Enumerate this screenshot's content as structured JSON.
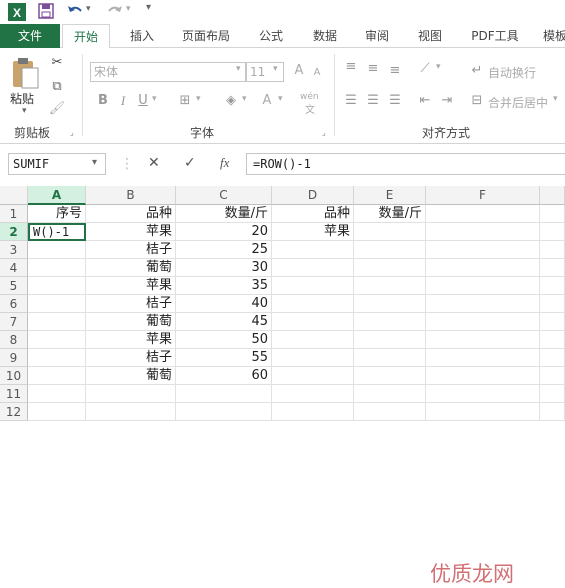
{
  "qat": {
    "excel_icon": "excel-logo-icon",
    "save_icon": "save-icon",
    "undo_icon": "undo-icon",
    "redo_icon": "redo-icon"
  },
  "tabs": {
    "file": "文件",
    "home": "开始",
    "insert": "插入",
    "layout": "页面布局",
    "formulas": "公式",
    "data": "数据",
    "review": "审阅",
    "view": "视图",
    "pdf": "PDF工具",
    "more": "模板"
  },
  "ribbon": {
    "paste": "粘贴",
    "clipboard_group": "剪贴板",
    "font_name": "宋体",
    "font_size": "11",
    "font_group": "字体",
    "bold": "B",
    "italic": "I",
    "underline": "U",
    "wen": "wén",
    "wrap": "自动换行",
    "merge": "合并后居中",
    "align_group": "对齐方式",
    "inc_font": "A",
    "dec_font": "A",
    "font_color": "A"
  },
  "formula_bar": {
    "name_box": "SUMIF",
    "cancel": "✕",
    "enter": "✓",
    "fx": "fx",
    "formula": "=ROW()-1"
  },
  "grid": {
    "columns": [
      "A",
      "B",
      "C",
      "D",
      "E",
      "F"
    ],
    "rows": [
      "1",
      "2",
      "3",
      "4",
      "5",
      "6",
      "7",
      "8",
      "9",
      "10",
      "11",
      "12"
    ],
    "cells": [
      [
        "序号",
        "品种",
        "数量/斤",
        "品种",
        "数量/斤",
        ""
      ],
      [
        "W()-1",
        "苹果",
        "20",
        "苹果",
        "",
        ""
      ],
      [
        "",
        "桔子",
        "25",
        "",
        "",
        ""
      ],
      [
        "",
        "葡萄",
        "30",
        "",
        "",
        ""
      ],
      [
        "",
        "苹果",
        "35",
        "",
        "",
        ""
      ],
      [
        "",
        "桔子",
        "40",
        "",
        "",
        ""
      ],
      [
        "",
        "葡萄",
        "45",
        "",
        "",
        ""
      ],
      [
        "",
        "苹果",
        "50",
        "",
        "",
        ""
      ],
      [
        "",
        "桔子",
        "55",
        "",
        "",
        ""
      ],
      [
        "",
        "葡萄",
        "60",
        "",
        "",
        ""
      ],
      [
        "",
        "",
        "",
        "",
        "",
        ""
      ],
      [
        "",
        "",
        "",
        "",
        "",
        ""
      ]
    ]
  },
  "watermark": "优质龙网",
  "colors": {
    "accent": "#217346",
    "file_tab": "#217346"
  }
}
